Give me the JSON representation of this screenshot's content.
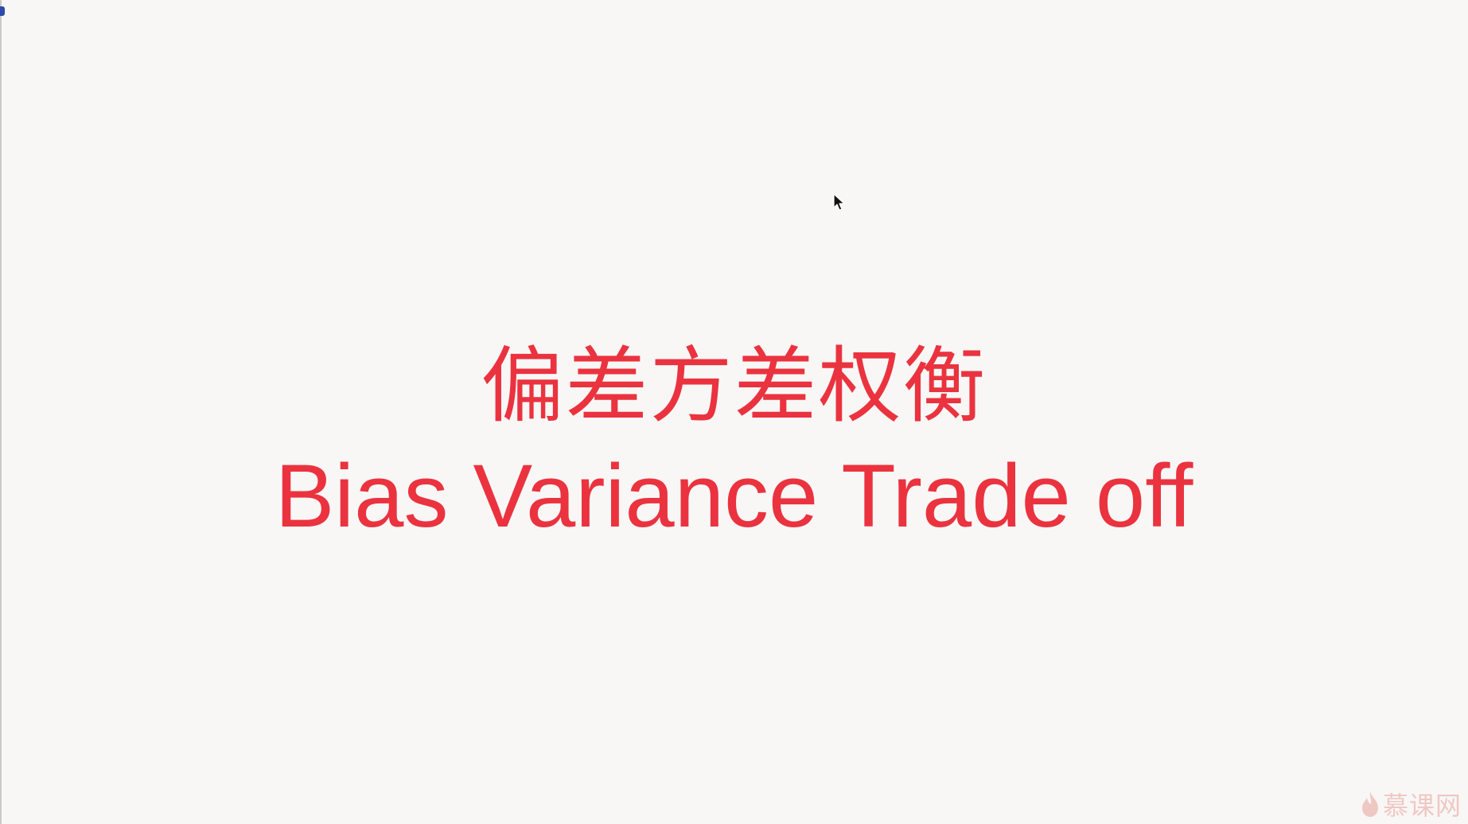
{
  "slide": {
    "title_cn": "偏差方差权衡",
    "title_en": "Bias Variance Trade off",
    "title_color": "#ea333f",
    "background_color": "#f8f7f6"
  },
  "watermark": {
    "text": "慕课网",
    "icon": "flame-icon"
  },
  "cursor": {
    "icon": "mouse-pointer-icon"
  }
}
